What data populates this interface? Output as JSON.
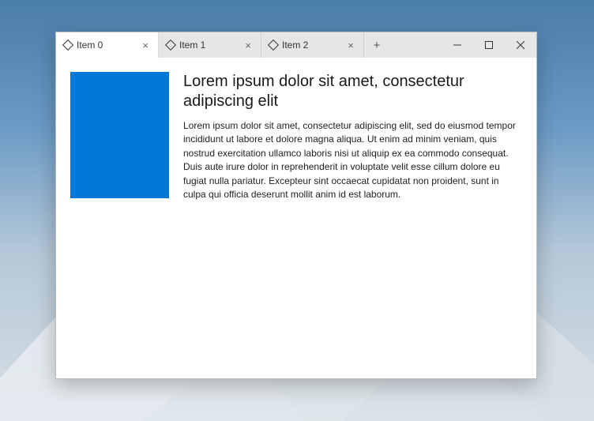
{
  "tabs": [
    {
      "label": "Item 0",
      "active": true
    },
    {
      "label": "Item 1",
      "active": false
    },
    {
      "label": "Item 2",
      "active": false
    }
  ],
  "newTab": "+",
  "closeGlyph": "×",
  "content": {
    "heading": "Lorem ipsum dolor sit amet, consectetur adipiscing elit",
    "body": "Lorem ipsum dolor sit amet, consectetur adipiscing elit, sed do eiusmod tempor incididunt ut labore et dolore magna aliqua. Ut enim ad minim veniam, quis nostrud exercitation ullamco laboris nisi ut aliquip ex ea commodo consequat. Duis aute irure dolor in reprehenderit in voluptate velit esse cillum dolore eu fugiat nulla pariatur. Excepteur sint occaecat cupidatat non proident, sunt in culpa qui officia deserunt mollit anim id est laborum."
  },
  "colors": {
    "accent": "#0078d7"
  }
}
